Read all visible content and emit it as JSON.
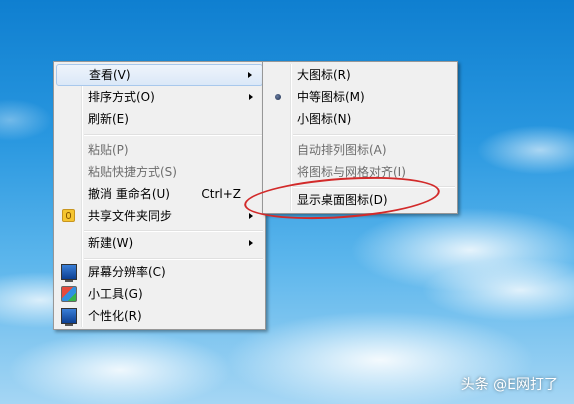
{
  "main_menu": {
    "view": "查看(V)",
    "sort_by": "排序方式(O)",
    "refresh": "刷新(E)",
    "paste": "粘贴(P)",
    "paste_shortcut": "粘贴快捷方式(S)",
    "undo_rename": "撤消 重命名(U)",
    "undo_shortcut": "Ctrl+Z",
    "share_sync": "共享文件夹同步",
    "new": "新建(W)",
    "screen_resolution": "屏幕分辨率(C)",
    "gadgets": "小工具(G)",
    "personalize": "个性化(R)"
  },
  "view_submenu": {
    "large_icons": "大图标(R)",
    "medium_icons": "中等图标(M)",
    "small_icons": "小图标(N)",
    "auto_arrange": "自动排列图标(A)",
    "align_to_grid": "将图标与网格对齐(I)",
    "show_desktop_icons": "显示桌面图标(D)",
    "selected": "medium_icons"
  },
  "watermark": "头条 @E网打了"
}
